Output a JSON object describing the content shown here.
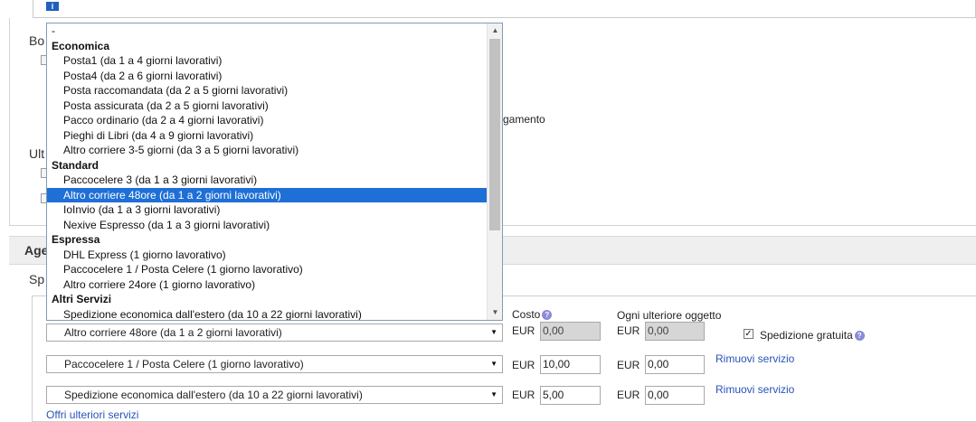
{
  "background_fragments": {
    "bo": "Bo",
    "ult": "Ult",
    "amento": "gamento",
    "ag": "Age",
    "sp": "Sp"
  },
  "info_banner": {
    "icon": "i",
    "icon_name": "info-icon"
  },
  "columns": {
    "cost_label": "Costo",
    "additional_label": "Ogni ulteriore oggetto",
    "help_icon": "?"
  },
  "dropdown": {
    "top_item": "-",
    "groups": [
      {
        "label": "Economica",
        "options": [
          "Posta1 (da 1 a 4 giorni lavorativi)",
          "Posta4 (da 2 a 6 giorni lavorativi)",
          "Posta raccomandata (da 2 a 5 giorni lavorativi)",
          "Posta assicurata (da 2 a 5 giorni lavorativi)",
          "Pacco ordinario (da 2 a 4 giorni lavorativi)",
          "Pieghi di Libri (da 4 a 9 giorni lavorativi)",
          "Altro corriere 3-5 giorni (da 3 a 5 giorni lavorativi)"
        ]
      },
      {
        "label": "Standard",
        "options": [
          "Paccocelere 3 (da 1 a 3 giorni lavorativi)",
          "Altro corriere 48ore (da 1 a 2 giorni lavorativi)",
          "IoInvio (da 1 a 3 giorni lavorativi)",
          "Nexive Espresso (da 1 a 3 giorni lavorativi)"
        ]
      },
      {
        "label": "Espressa",
        "options": [
          "DHL Express (1 giorno lavorativo)",
          "Paccocelere 1 / Posta Celere (1 giorno lavorativo)",
          "Altro corriere 24ore (1 giorno lavorativo)"
        ]
      },
      {
        "label": "Altri Servizi",
        "options": [
          "Spedizione economica dall'estero (da 10 a 22 giorni lavorativi)"
        ]
      }
    ],
    "highlighted": "Altro corriere 48ore (da 1 a 2 giorni lavorativi)"
  },
  "services": [
    {
      "service": "Altro corriere 48ore (da 1 a 2 giorni lavorativi)",
      "currency": "EUR",
      "cost": "0,00",
      "additional_currency": "EUR",
      "additional": "0,00",
      "free_shipping_label": "Spedizione gratuita",
      "free_shipping_checked": true
    },
    {
      "service": "Paccocelere 1 / Posta Celere (1 giorno lavorativo)",
      "currency": "EUR",
      "cost": "10,00",
      "additional_currency": "EUR",
      "additional": "0,00",
      "remove_label": "Rimuovi servizio"
    },
    {
      "service": "Spedizione economica dall'estero (da 10 a 22 giorni lavorativi)",
      "currency": "EUR",
      "cost": "5,00",
      "additional_currency": "EUR",
      "additional": "0,00",
      "remove_label": "Rimuovi servizio"
    }
  ],
  "more_services_link": "Offri ulteriori servizi",
  "colors": {
    "selection": "#1e6fd6",
    "link": "#2a53b8",
    "disabled_input": "#d6d6d6"
  }
}
